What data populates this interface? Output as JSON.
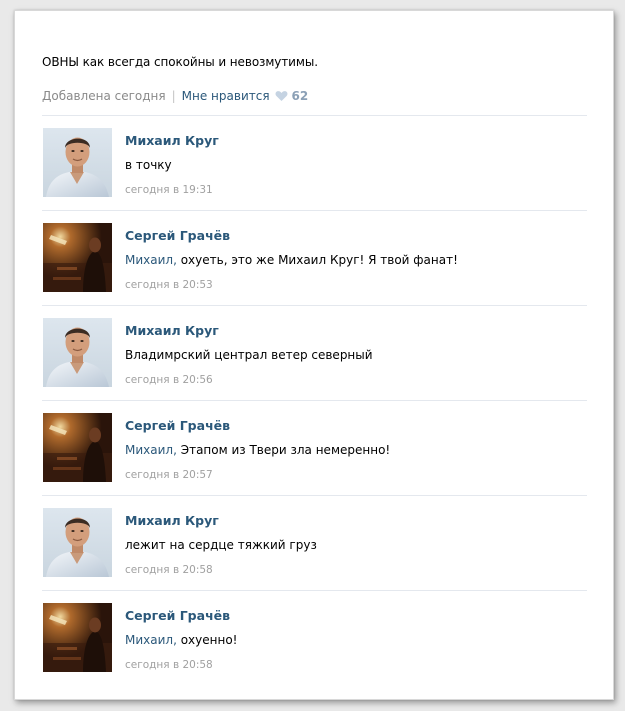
{
  "post": {
    "text": "ОВНЫ как всегда спокойны и невозмутимы.",
    "added": "Добавлена сегодня",
    "separator": "|",
    "like_label": "Мне нравится",
    "like_count": "62"
  },
  "comments": [
    {
      "author": "Михаил Круг",
      "reply_to": "",
      "text": "в точку",
      "time": "сегодня в 19:31",
      "avatar": "man-white-shirt"
    },
    {
      "author": "Сергей Грачёв",
      "reply_to": "Михаил,",
      "text": " охуеть, это же Михаил Круг! Я твой фанат!",
      "time": "сегодня в 20:53",
      "avatar": "dark-stage-photo"
    },
    {
      "author": "Михаил Круг",
      "reply_to": "",
      "text": "Владимрский централ ветер северный",
      "time": "сегодня в 20:56",
      "avatar": "man-white-shirt"
    },
    {
      "author": "Сергей Грачёв",
      "reply_to": "Михаил,",
      "text": " Этапом из Твери зла немеренно!",
      "time": "сегодня в 20:57",
      "avatar": "dark-stage-photo"
    },
    {
      "author": "Михаил Круг",
      "reply_to": "",
      "text": "лежит на сердце тяжкий груз",
      "time": "сегодня в 20:58",
      "avatar": "man-white-shirt"
    },
    {
      "author": "Сергей Грачёв",
      "reply_to": "Михаил,",
      "text": " охуенно!",
      "time": "сегодня в 20:58",
      "avatar": "dark-stage-photo"
    }
  ],
  "colors": {
    "link": "#2b587a",
    "meta": "#8a8a8a",
    "time": "#a0a0a0",
    "like_count": "#8ba0b6"
  }
}
